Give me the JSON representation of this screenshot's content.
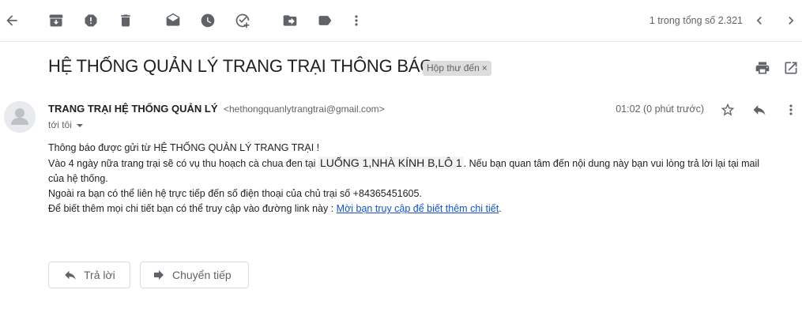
{
  "toolbar": {
    "icons": [
      "back-arrow-icon",
      "archive-icon",
      "report-spam-icon",
      "delete-icon",
      "mark-unread-icon",
      "snooze-icon",
      "add-task-icon",
      "move-to-icon",
      "labels-icon",
      "more-vert-icon"
    ],
    "count": "1 trong tổng số 2.321"
  },
  "subject": "HỆ THỐNG QUẢN LÝ TRANG TRẠI THÔNG BÁO",
  "label": "Hộp thư đến",
  "label_close": "×",
  "message": {
    "sender_name": "TRANG TRẠI HỆ THỐNG QUẢN LÝ",
    "sender_email": "<hethongquanlytrangtrai@gmail.com>",
    "recipient": "tới tôi",
    "time": "01:02 (0 phút trước)",
    "body": {
      "line1": "Thông báo được gửi từ HỆ THỐNG QUẢN LÝ TRANG TRẠI !",
      "line2_pre": "Vào 4 ngày nữa trang trại sẽ có vụ thu hoạch cà chua đen tại ",
      "line2_highlight": "LUỐNG 1,NHÀ KÍNH B,LÔ 1",
      "line2_post": ". Nếu bạn quan tâm đến nội dung này bạn vui lòng trả lời lại tại mail của hệ thống.",
      "line3": "Ngoài ra bạn có thể liên hệ trực tiếp đến số điện thoại của chủ trại số +84365451605.",
      "line4_pre": "Để biết thêm mọi chi tiết bạn có thể truy cập vào đường link này : ",
      "line4_link": "Mời bạn truy cập để biết thêm chi tiết",
      "line4_post": "."
    }
  },
  "actions": {
    "reply": "Trả lời",
    "forward": "Chuyển tiếp"
  },
  "colors": {
    "icon": "#5f6368",
    "link": "#1155cc",
    "chip_bg": "#dddddd"
  }
}
